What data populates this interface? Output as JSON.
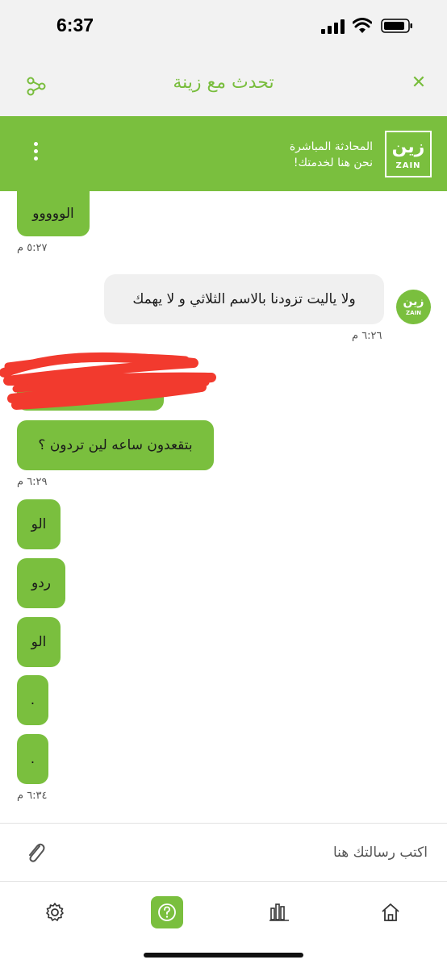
{
  "status_bar": {
    "time": "6:37"
  },
  "header": {
    "title": "تحدث مع زينة"
  },
  "banner": {
    "title": "المحادثة المباشرة",
    "subtitle": "نحن هنا لخدمتك!",
    "logo_ar": "زين",
    "logo_en": "ZAIN"
  },
  "messages": {
    "m1": {
      "text": "الووووو",
      "time": "٥:٢٧ م"
    },
    "m2": {
      "text": "ولا ياليت تزودنا بالاسم الثلاثي و لا يهمك",
      "time": "٦:٢٦ م"
    },
    "m3": {
      "text": "بتقعدون ساعه لين تردون ؟",
      "time": "٦:٢٩ م"
    },
    "m4": {
      "text": "الو"
    },
    "m5": {
      "text": "ردو"
    },
    "m6": {
      "text": "الو"
    },
    "m7": {
      "text": "."
    },
    "m8": {
      "text": ".",
      "time": "٦:٣٤ م"
    }
  },
  "input": {
    "placeholder": "اكتب رسالتك هنا"
  },
  "nav": [
    "home-icon",
    "stats-icon",
    "help-icon",
    "settings-icon"
  ],
  "colors": {
    "brand_green": "#7abf3e",
    "title_green": "#78bd3c",
    "agent_bubble": "#f0f0f0"
  }
}
